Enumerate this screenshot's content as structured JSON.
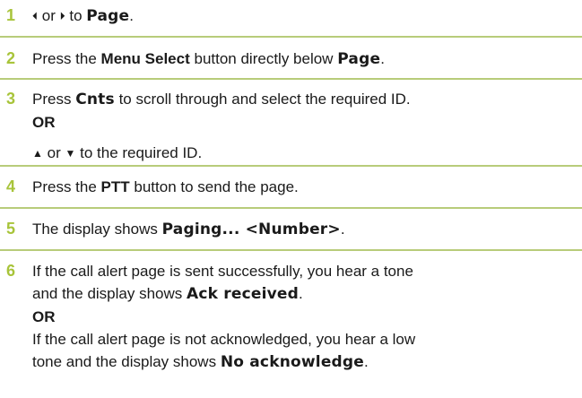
{
  "accent_color": "#a8c43a",
  "rule_color": "#b8cc7a",
  "steps": [
    {
      "number": "1",
      "arrow_left": "⏴",
      "t1": "or",
      "arrow_right": "⏵",
      "t2": "to",
      "disp": "Page",
      "t3": "."
    },
    {
      "number": "2",
      "t1": "Press the",
      "bold1": "Menu Select",
      "t2": "button directly below",
      "disp": "Page",
      "t3": "."
    },
    {
      "number": "3",
      "t1": "Press",
      "disp": "Cnts",
      "t2": "to scroll through and select the required ID.",
      "or": "OR",
      "arrow_up": "▲",
      "t3": "or",
      "arrow_down": "▼",
      "t4": "to the required ID."
    },
    {
      "number": "4",
      "t1": "Press the",
      "bold1": "PTT",
      "t2": "button to send the page."
    },
    {
      "number": "5",
      "t1": "The display shows",
      "disp": "Paging... <Number>",
      "t2": "."
    },
    {
      "number": "6",
      "t1": "If the call alert page is sent successfully, you hear a tone",
      "t2": "and the display shows",
      "disp1": "Ack received",
      "t3": ".",
      "or": "OR",
      "t4": "If the call alert page is not acknowledged, you hear a low",
      "t5": "tone and the display shows",
      "disp2": "No acknowledge",
      "t6": "."
    }
  ]
}
